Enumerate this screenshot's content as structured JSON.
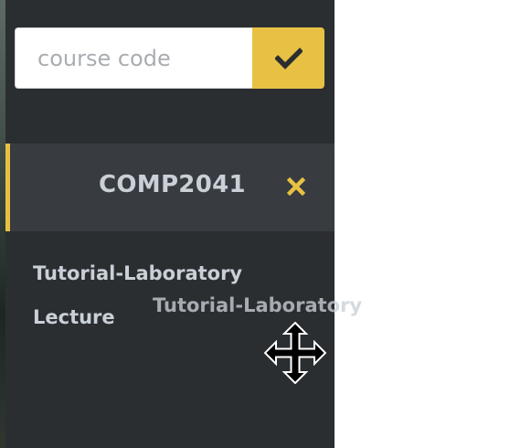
{
  "search": {
    "placeholder": "course code",
    "submit_icon": "checkmark-icon"
  },
  "courses": [
    {
      "code": "COMP2041",
      "remove_icon": "close-icon",
      "class_types": [
        "Tutorial-Laboratory",
        "Lecture"
      ]
    }
  ],
  "drag": {
    "ghost_label": "Tutorial-Laboratory",
    "cursor_icon": "move-cursor-icon"
  },
  "colors": {
    "panel_bg": "#2b2e31",
    "course_item_bg": "#383c40",
    "accent": "#e8c144",
    "text": "#c9d0d7"
  }
}
